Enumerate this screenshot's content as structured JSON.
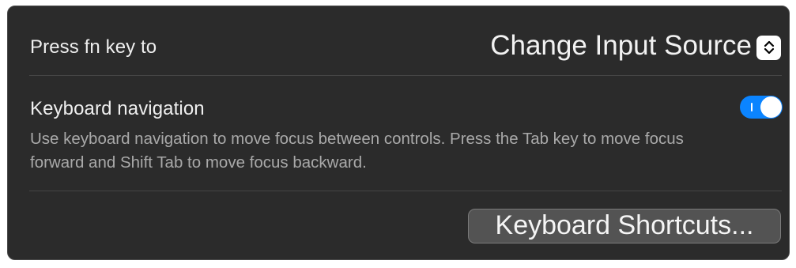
{
  "fn_key": {
    "label": "Press fn key to",
    "selected_value": "Change Input Source",
    "stepper_icon": "chevron-up-down-icon"
  },
  "keyboard_navigation": {
    "label": "Keyboard navigation",
    "description": "Use keyboard navigation to move focus between controls. Press the Tab key to move focus forward and Shift Tab to move focus backward.",
    "enabled": true
  },
  "shortcuts_button": {
    "label": "Keyboard Shortcuts..."
  },
  "colors": {
    "panel_background": "#2b2b2b",
    "toggle_accent": "#0b84ff",
    "button_background": "#535353"
  }
}
